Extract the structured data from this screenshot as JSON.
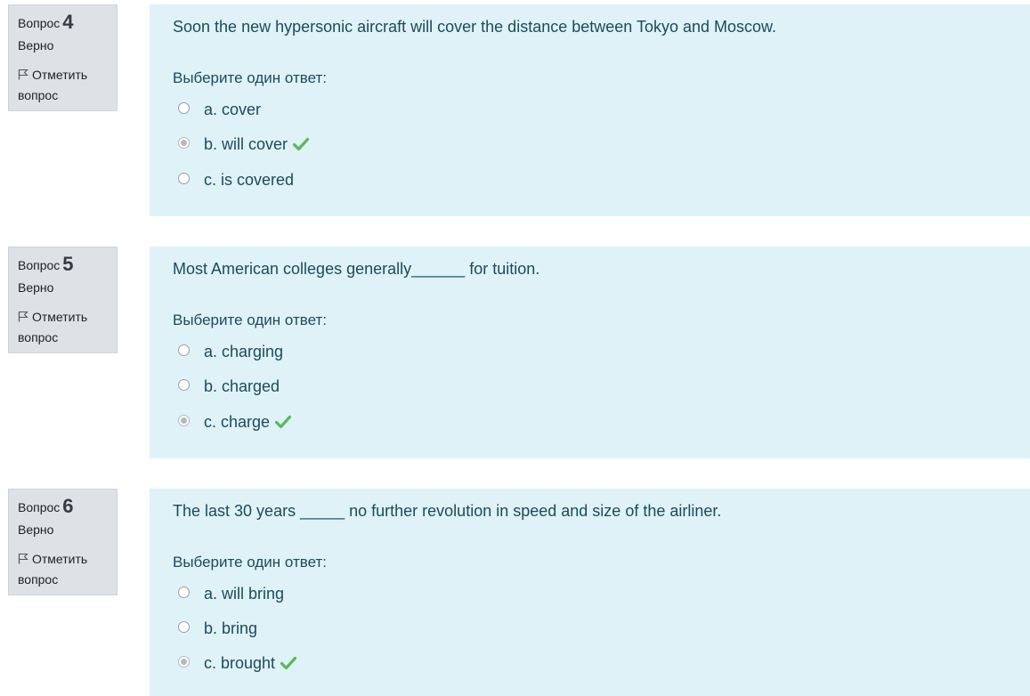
{
  "questions": [
    {
      "label": "Вопрос",
      "number": "4",
      "state": "Верно",
      "flag_line1": "Отметить",
      "flag_line2": "вопрос",
      "text": "Soon the new hypersonic aircraft will cover the distance between Tokyo and Moscow.",
      "prompt": "Выберите один ответ:",
      "answers": [
        {
          "label": "a. cover",
          "selected": false,
          "correct": false
        },
        {
          "label": "b. will cover",
          "selected": true,
          "correct": true
        },
        {
          "label": "c. is covered",
          "selected": false,
          "correct": false
        }
      ]
    },
    {
      "label": "Вопрос",
      "number": "5",
      "state": "Верно",
      "flag_line1": "Отметить",
      "flag_line2": "вопрос",
      "text": "Most American colleges generally______ for tuition.",
      "prompt": "Выберите один ответ:",
      "answers": [
        {
          "label": "a. charging",
          "selected": false,
          "correct": false
        },
        {
          "label": "b. charged",
          "selected": false,
          "correct": false
        },
        {
          "label": "c. charge",
          "selected": true,
          "correct": true
        }
      ]
    },
    {
      "label": "Вопрос",
      "number": "6",
      "state": "Верно",
      "flag_line1": "Отметить",
      "flag_line2": "вопрос",
      "text": "The last 30 years _____ no further revolution in speed and size of the airliner.",
      "prompt": "Выберите один ответ:",
      "answers": [
        {
          "label": "a. will bring",
          "selected": false,
          "correct": false
        },
        {
          "label": "b. bring",
          "selected": false,
          "correct": false
        },
        {
          "label": "c. brought",
          "selected": true,
          "correct": true
        }
      ]
    }
  ],
  "icons": {
    "flag": "flag-icon",
    "correct": "check-icon"
  },
  "colors": {
    "info_bg": "#dee2e6",
    "content_bg": "#def2f8",
    "correct_check": "#5cb85c"
  }
}
